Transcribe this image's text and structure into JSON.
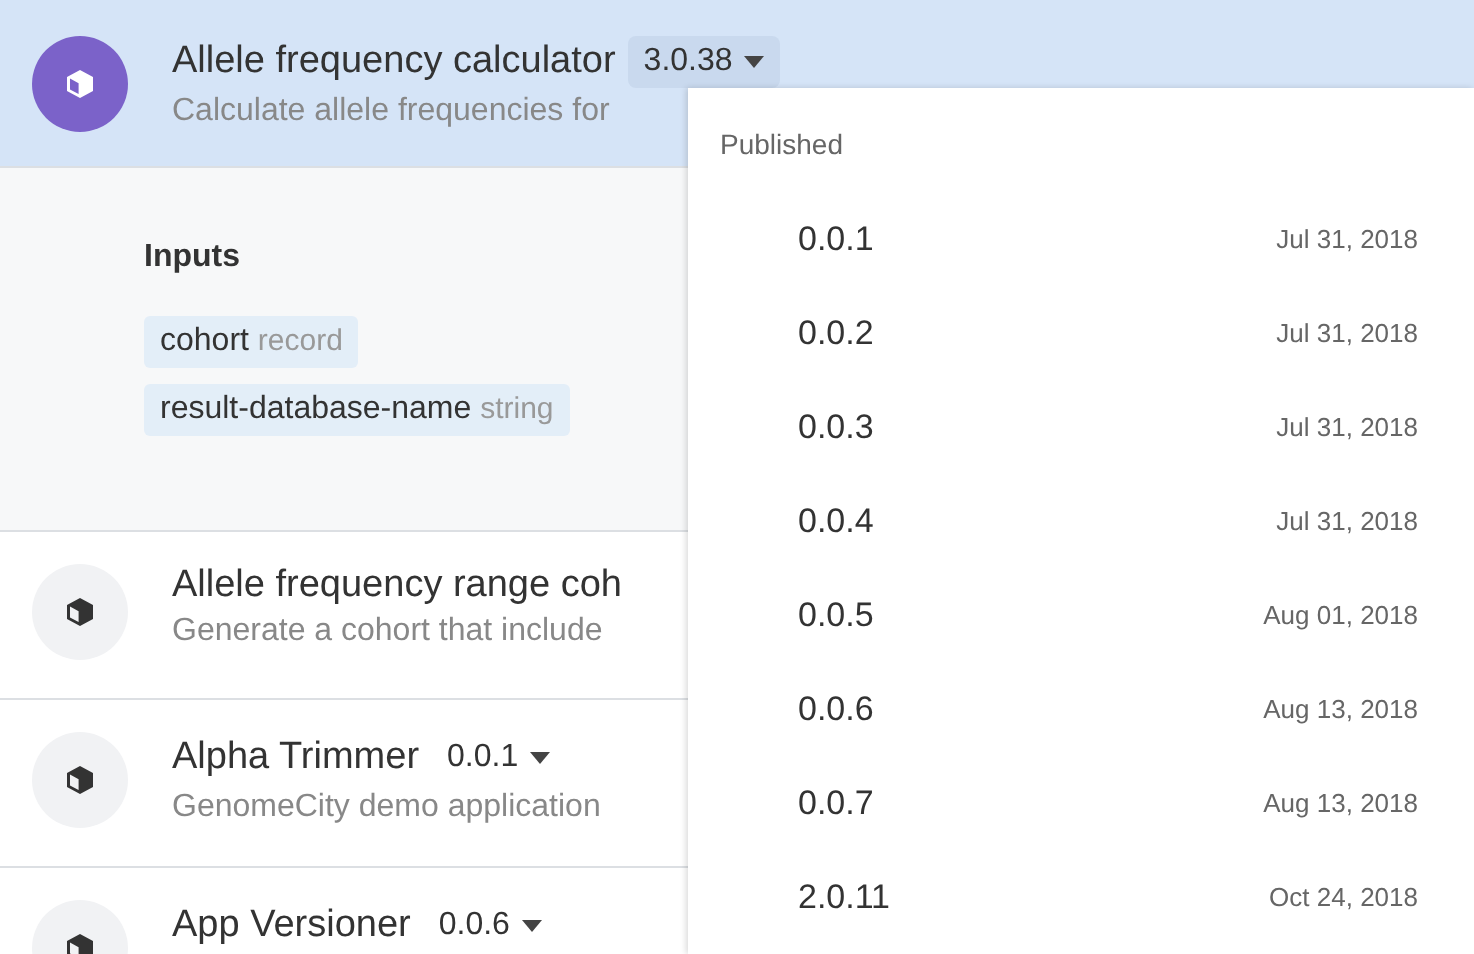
{
  "apps": [
    {
      "name": "Allele frequency calculator",
      "version": "3.0.38",
      "description": "Calculate allele frequencies for",
      "selected": true,
      "expanded": true,
      "inputs_title": "Inputs",
      "inputs": [
        {
          "name": "cohort",
          "type": "record"
        },
        {
          "name": "result-database-name",
          "type": "string"
        }
      ]
    },
    {
      "name": "Allele frequency range coh",
      "description": "Generate a cohort that include",
      "selected": false,
      "expanded": false
    },
    {
      "name": "Alpha Trimmer",
      "version": "0.0.1",
      "description": "GenomeCity demo application",
      "selected": false,
      "expanded": false
    },
    {
      "name": "App Versioner",
      "version": "0.0.6",
      "selected": false,
      "expanded": false
    }
  ],
  "version_menu": {
    "section": "Published",
    "items": [
      {
        "version": "0.0.1",
        "date": "Jul 31, 2018"
      },
      {
        "version": "0.0.2",
        "date": "Jul 31, 2018"
      },
      {
        "version": "0.0.3",
        "date": "Jul 31, 2018"
      },
      {
        "version": "0.0.4",
        "date": "Jul 31, 2018"
      },
      {
        "version": "0.0.5",
        "date": "Aug 01, 2018"
      },
      {
        "version": "0.0.6",
        "date": "Aug 13, 2018"
      },
      {
        "version": "0.0.7",
        "date": "Aug 13, 2018"
      },
      {
        "version": "2.0.11",
        "date": "Oct 24, 2018"
      }
    ]
  }
}
